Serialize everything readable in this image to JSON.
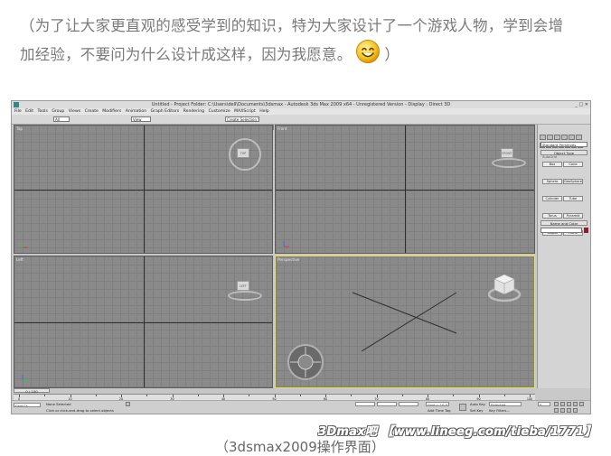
{
  "intro_text": {
    "line1": "（为了让大家更直观的感受学到的知识，特为大家设计了一个游戏人物，学到会增",
    "line2_before_emoji": "加经验，不要问为什么设计成这样，因为我愿意。",
    "line2_after_emoji": "）"
  },
  "app": {
    "title": "Untitled    - Project Folder: C:\\Users\\dell\\Documents\\3dsmax    - Autodesk 3ds Max  2009 x64  -  Unregistered Version   - Display : Direct 3D",
    "window_controls": "_ □ ✕",
    "menu": [
      "File",
      "Edit",
      "Tools",
      "Group",
      "Views",
      "Create",
      "Modifiers",
      "Animation",
      "Graph Editors",
      "Rendering",
      "Customize",
      "MAXScript",
      "Help"
    ],
    "toolbar": {
      "selection_filter": "All",
      "reference_coord": "View",
      "named_selection": "Create Selection Set"
    },
    "viewports": [
      {
        "label": "Top",
        "cube_label": "TOP",
        "active": false
      },
      {
        "label": "Front",
        "cube_label": "FRONT",
        "active": false
      },
      {
        "label": "Left",
        "cube_label": "LEFT",
        "active": false
      },
      {
        "label": "Perspective",
        "cube_label": "",
        "active": true
      }
    ],
    "command_panel": {
      "dropdown": "Standard Primitives",
      "object_type_title": "Object Type",
      "autogrid": "AutoGrid",
      "primitives": [
        "Box",
        "Cone",
        "Sphere",
        "GeoSphere",
        "Cylinder",
        "Tube",
        "Torus",
        "Pyramid",
        "Teapot",
        "Plane"
      ],
      "name_color_title": "Name and Color",
      "name_value": "",
      "color": "#8c1d35"
    },
    "timeline": {
      "frame_slider": "0 / 100",
      "ticks": [
        "0",
        "10",
        "20",
        "30",
        "40",
        "50",
        "60",
        "70",
        "80",
        "90",
        "100"
      ]
    },
    "status_bar": {
      "script_listener": "Grid.Cs",
      "selection_status": "None Selected",
      "prompt": "Click or click-and-drag to select objects",
      "grid": "Grid = 10.0",
      "add_time_tag": "Add Time Tag",
      "auto_key": "Auto Key",
      "key_mode": "Selected",
      "set_key": "Set Key",
      "key_filters": "Key Filters...",
      "frame": "0"
    }
  },
  "watermark": "3Dmax吧 【www.lineeg.com/tieba/1771】",
  "caption": "（3dsmax2009操作界面）"
}
